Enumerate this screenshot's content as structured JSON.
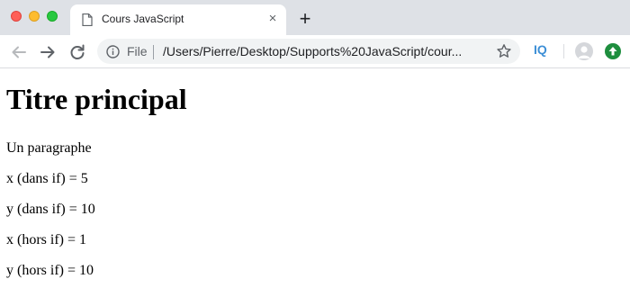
{
  "tab": {
    "title": "Cours JavaScript",
    "close_symbol": "×"
  },
  "new_tab_symbol": "+",
  "address_bar": {
    "scheme": "File",
    "url": "/Users/Pierre/Desktop/Supports%20JavaScript/cour..."
  },
  "toolbar": {
    "extension_label": "IQ"
  },
  "colors": {
    "update_button": "#1e8e3e",
    "extension": "#3d8fd6"
  },
  "page": {
    "heading": "Titre principal",
    "paragraphs": [
      "Un paragraphe",
      "x (dans if) = 5",
      "y (dans if) = 10",
      "x (hors if) = 1",
      "y (hors if) = 10"
    ]
  }
}
